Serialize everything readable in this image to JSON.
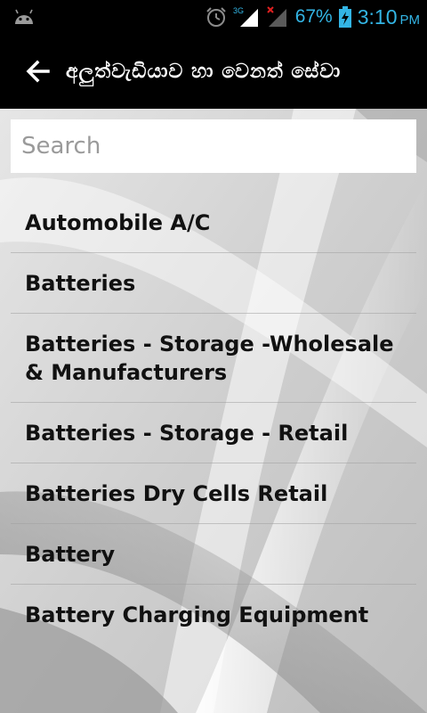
{
  "status_bar": {
    "network_label": "3G",
    "battery_percent": "67%",
    "time": "3:10",
    "ampm": "PM",
    "accent_color": "#33b5e5"
  },
  "action_bar": {
    "title": "අලුත්වැඩියාව හා වෙනත් සේවා",
    "back_icon": "back-arrow-icon"
  },
  "search": {
    "placeholder": "Search",
    "value": ""
  },
  "list": {
    "items": [
      {
        "label": "Automobile A/C"
      },
      {
        "label": "Batteries"
      },
      {
        "label": "Batteries - Storage -Wholesale & Manufacturers"
      },
      {
        "label": "Batteries - Storage - Retail"
      },
      {
        "label": "Batteries Dry Cells Retail"
      },
      {
        "label": "Battery"
      },
      {
        "label": "Battery Charging Equipment"
      }
    ]
  }
}
